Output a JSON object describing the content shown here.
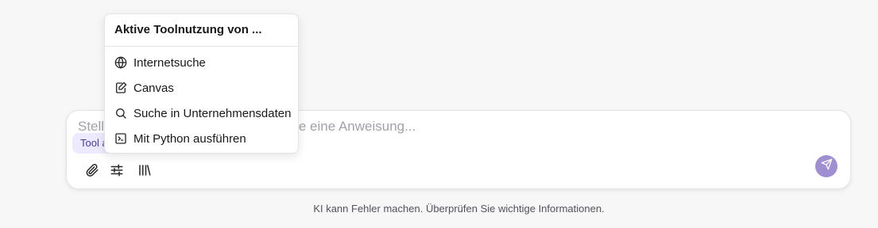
{
  "composer": {
    "placeholder": "Stellen Sie eine Frage oder geben Sie eine Anweisung...",
    "value": "",
    "tool_chip_label": "Tool aktiv"
  },
  "toolbar": {
    "attach_icon": "paperclip-icon",
    "settings_icon": "sliders-icon",
    "library_icon": "library-icon",
    "send_icon": "send-icon"
  },
  "dropdown": {
    "title": "Aktive Toolnutzung von ...",
    "items": [
      {
        "label": "Internetsuche",
        "icon": "globe-icon"
      },
      {
        "label": "Canvas",
        "icon": "canvas-edit-icon"
      },
      {
        "label": "Suche in Unternehmensdaten",
        "icon": "search-icon"
      },
      {
        "label": "Mit Python ausführen",
        "icon": "terminal-icon"
      }
    ]
  },
  "footer": {
    "note": "KI kann Fehler machen. Überprüfen Sie wichtige Informationen."
  },
  "colors": {
    "accent": "#a08fd0",
    "chip_bg": "#ede9fe",
    "background": "#f7f7f8"
  }
}
